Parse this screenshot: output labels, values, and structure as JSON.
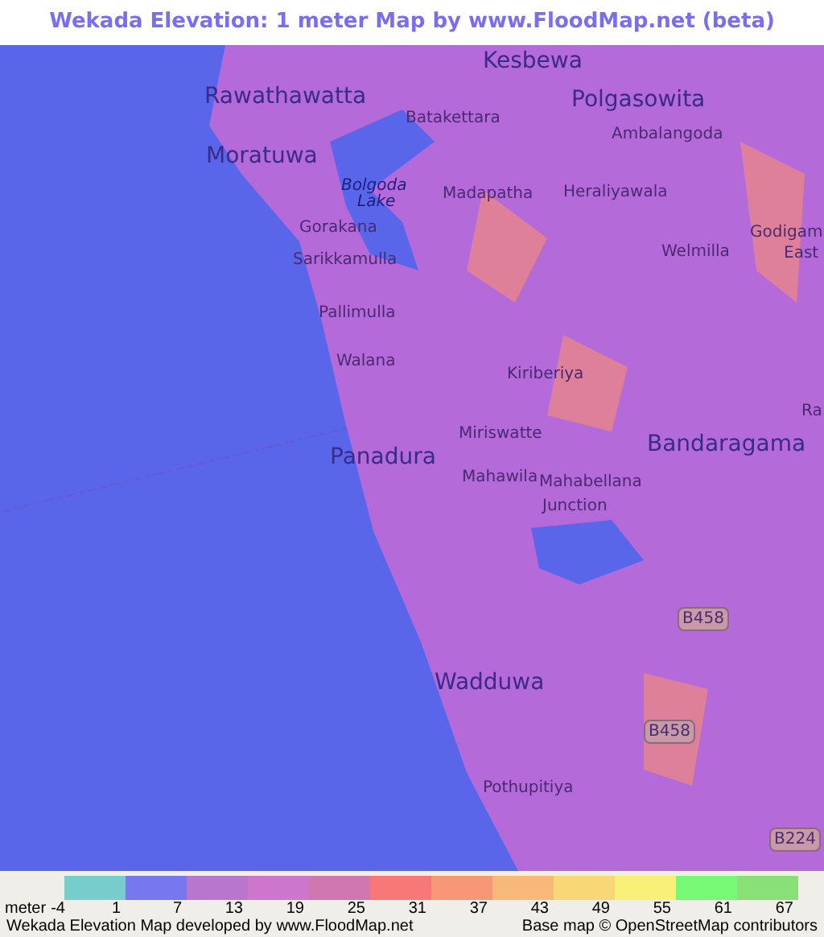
{
  "title": "Wekada Elevation: 1 meter Map by www.FloodMap.net (beta)",
  "map": {
    "labels": [
      {
        "text": "Kesbewa",
        "kind": "large"
      },
      {
        "text": "Rawathawatta",
        "kind": "large"
      },
      {
        "text": "Polgasowita",
        "kind": "large"
      },
      {
        "text": "Batakettara",
        "kind": "small"
      },
      {
        "text": "Ambalangoda",
        "kind": "small"
      },
      {
        "text": "Moratuwa",
        "kind": "large"
      },
      {
        "text": "Bolgoda",
        "kind": "water"
      },
      {
        "text": "Lake",
        "kind": "water"
      },
      {
        "text": "Madapatha",
        "kind": "small"
      },
      {
        "text": "Heraliyawala",
        "kind": "small"
      },
      {
        "text": "Gorakana",
        "kind": "small"
      },
      {
        "text": "Godigam",
        "kind": "small"
      },
      {
        "text": "Welmilla",
        "kind": "small"
      },
      {
        "text": "East",
        "kind": "small"
      },
      {
        "text": "Sarikkamulla",
        "kind": "small"
      },
      {
        "text": "Pallimulla",
        "kind": "small"
      },
      {
        "text": "Walana",
        "kind": "small"
      },
      {
        "text": "Kiriberiya",
        "kind": "small"
      },
      {
        "text": "Ra",
        "kind": "small"
      },
      {
        "text": "Miriswatte",
        "kind": "small"
      },
      {
        "text": "Bandaragama",
        "kind": "large"
      },
      {
        "text": "Panadura",
        "kind": "large"
      },
      {
        "text": "Mahawila",
        "kind": "small"
      },
      {
        "text": "Mahabellana",
        "kind": "small"
      },
      {
        "text": "Junction",
        "kind": "small"
      },
      {
        "text": "B458",
        "kind": "shield"
      },
      {
        "text": "Wadduwa",
        "kind": "large"
      },
      {
        "text": "B458",
        "kind": "shield"
      },
      {
        "text": "Pothupitiya",
        "kind": "small"
      },
      {
        "text": "B224",
        "kind": "shield"
      }
    ]
  },
  "legend": {
    "unit": "meter",
    "ticks": [
      "-4",
      "1",
      "7",
      "13",
      "19",
      "25",
      "31",
      "37",
      "43",
      "49",
      "55",
      "61",
      "67"
    ],
    "swatches": [
      {
        "color": "#77cccc"
      },
      {
        "color": "#7777f0"
      },
      {
        "color": "#b877cc"
      },
      {
        "color": "#cc77cc"
      },
      {
        "color": "#d077b0"
      },
      {
        "color": "#f87777"
      },
      {
        "color": "#f89777"
      },
      {
        "color": "#f8b877"
      },
      {
        "color": "#f8d777"
      },
      {
        "color": "#f8f077"
      },
      {
        "color": "#77f877"
      },
      {
        "color": "#88e077"
      }
    ]
  },
  "footer": {
    "left": "Wekada Elevation Map developed by www.FloodMap.net",
    "right": "Base map © OpenStreetMap contributors"
  }
}
